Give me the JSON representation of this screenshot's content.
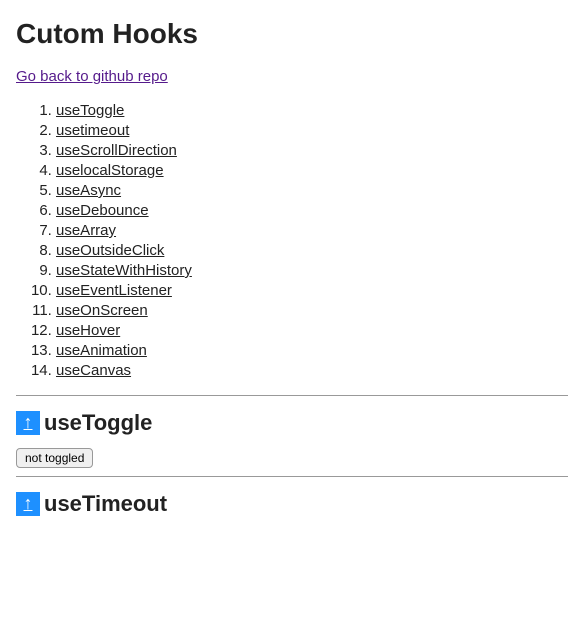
{
  "title": "Cutom Hooks",
  "repo_link_text": "Go back to github repo",
  "hooks_list": {
    "item_1": "useToggle",
    "item_2": "usetimeout",
    "item_3": "useScrollDirection",
    "item_4": "uselocalStorage",
    "item_5": "useAsync",
    "item_6": "useDebounce",
    "item_7": "useArray",
    "item_8": "useOutsideClick",
    "item_9": "useStateWithHistory",
    "item_10": "useEventListener",
    "item_11": "useOnScreen",
    "item_12": "useHover",
    "item_13": "useAnimation",
    "item_14": "useCanvas"
  },
  "sections": {
    "useToggle": {
      "heading": "useToggle",
      "button_label": "not toggled"
    },
    "useTimeout": {
      "heading": "useTimeout"
    }
  },
  "icons": {
    "up_arrow": "↑"
  }
}
